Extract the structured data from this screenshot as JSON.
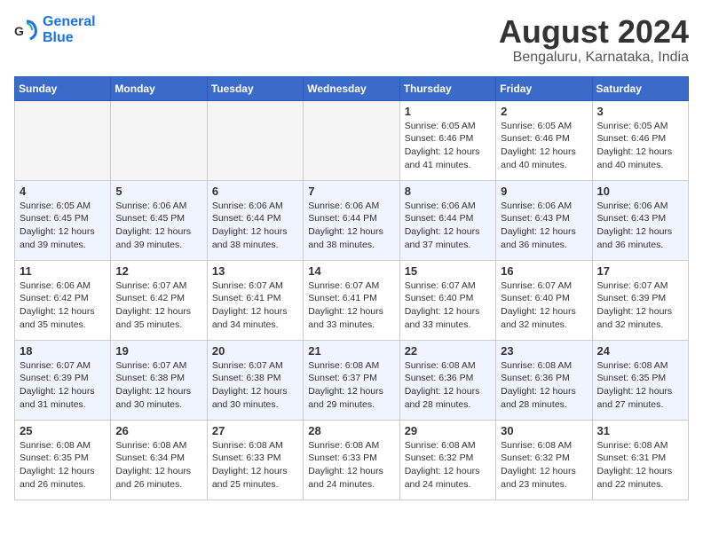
{
  "header": {
    "logo_line1": "General",
    "logo_line2": "Blue",
    "month_year": "August 2024",
    "location": "Bengaluru, Karnataka, India"
  },
  "weekdays": [
    "Sunday",
    "Monday",
    "Tuesday",
    "Wednesday",
    "Thursday",
    "Friday",
    "Saturday"
  ],
  "weeks": [
    [
      {
        "day": "",
        "info": ""
      },
      {
        "day": "",
        "info": ""
      },
      {
        "day": "",
        "info": ""
      },
      {
        "day": "",
        "info": ""
      },
      {
        "day": "1",
        "info": "Sunrise: 6:05 AM\nSunset: 6:46 PM\nDaylight: 12 hours\nand 41 minutes."
      },
      {
        "day": "2",
        "info": "Sunrise: 6:05 AM\nSunset: 6:46 PM\nDaylight: 12 hours\nand 40 minutes."
      },
      {
        "day": "3",
        "info": "Sunrise: 6:05 AM\nSunset: 6:46 PM\nDaylight: 12 hours\nand 40 minutes."
      }
    ],
    [
      {
        "day": "4",
        "info": "Sunrise: 6:05 AM\nSunset: 6:45 PM\nDaylight: 12 hours\nand 39 minutes."
      },
      {
        "day": "5",
        "info": "Sunrise: 6:06 AM\nSunset: 6:45 PM\nDaylight: 12 hours\nand 39 minutes."
      },
      {
        "day": "6",
        "info": "Sunrise: 6:06 AM\nSunset: 6:44 PM\nDaylight: 12 hours\nand 38 minutes."
      },
      {
        "day": "7",
        "info": "Sunrise: 6:06 AM\nSunset: 6:44 PM\nDaylight: 12 hours\nand 38 minutes."
      },
      {
        "day": "8",
        "info": "Sunrise: 6:06 AM\nSunset: 6:44 PM\nDaylight: 12 hours\nand 37 minutes."
      },
      {
        "day": "9",
        "info": "Sunrise: 6:06 AM\nSunset: 6:43 PM\nDaylight: 12 hours\nand 36 minutes."
      },
      {
        "day": "10",
        "info": "Sunrise: 6:06 AM\nSunset: 6:43 PM\nDaylight: 12 hours\nand 36 minutes."
      }
    ],
    [
      {
        "day": "11",
        "info": "Sunrise: 6:06 AM\nSunset: 6:42 PM\nDaylight: 12 hours\nand 35 minutes."
      },
      {
        "day": "12",
        "info": "Sunrise: 6:07 AM\nSunset: 6:42 PM\nDaylight: 12 hours\nand 35 minutes."
      },
      {
        "day": "13",
        "info": "Sunrise: 6:07 AM\nSunset: 6:41 PM\nDaylight: 12 hours\nand 34 minutes."
      },
      {
        "day": "14",
        "info": "Sunrise: 6:07 AM\nSunset: 6:41 PM\nDaylight: 12 hours\nand 33 minutes."
      },
      {
        "day": "15",
        "info": "Sunrise: 6:07 AM\nSunset: 6:40 PM\nDaylight: 12 hours\nand 33 minutes."
      },
      {
        "day": "16",
        "info": "Sunrise: 6:07 AM\nSunset: 6:40 PM\nDaylight: 12 hours\nand 32 minutes."
      },
      {
        "day": "17",
        "info": "Sunrise: 6:07 AM\nSunset: 6:39 PM\nDaylight: 12 hours\nand 32 minutes."
      }
    ],
    [
      {
        "day": "18",
        "info": "Sunrise: 6:07 AM\nSunset: 6:39 PM\nDaylight: 12 hours\nand 31 minutes."
      },
      {
        "day": "19",
        "info": "Sunrise: 6:07 AM\nSunset: 6:38 PM\nDaylight: 12 hours\nand 30 minutes."
      },
      {
        "day": "20",
        "info": "Sunrise: 6:07 AM\nSunset: 6:38 PM\nDaylight: 12 hours\nand 30 minutes."
      },
      {
        "day": "21",
        "info": "Sunrise: 6:08 AM\nSunset: 6:37 PM\nDaylight: 12 hours\nand 29 minutes."
      },
      {
        "day": "22",
        "info": "Sunrise: 6:08 AM\nSunset: 6:36 PM\nDaylight: 12 hours\nand 28 minutes."
      },
      {
        "day": "23",
        "info": "Sunrise: 6:08 AM\nSunset: 6:36 PM\nDaylight: 12 hours\nand 28 minutes."
      },
      {
        "day": "24",
        "info": "Sunrise: 6:08 AM\nSunset: 6:35 PM\nDaylight: 12 hours\nand 27 minutes."
      }
    ],
    [
      {
        "day": "25",
        "info": "Sunrise: 6:08 AM\nSunset: 6:35 PM\nDaylight: 12 hours\nand 26 minutes."
      },
      {
        "day": "26",
        "info": "Sunrise: 6:08 AM\nSunset: 6:34 PM\nDaylight: 12 hours\nand 26 minutes."
      },
      {
        "day": "27",
        "info": "Sunrise: 6:08 AM\nSunset: 6:33 PM\nDaylight: 12 hours\nand 25 minutes."
      },
      {
        "day": "28",
        "info": "Sunrise: 6:08 AM\nSunset: 6:33 PM\nDaylight: 12 hours\nand 24 minutes."
      },
      {
        "day": "29",
        "info": "Sunrise: 6:08 AM\nSunset: 6:32 PM\nDaylight: 12 hours\nand 24 minutes."
      },
      {
        "day": "30",
        "info": "Sunrise: 6:08 AM\nSunset: 6:32 PM\nDaylight: 12 hours\nand 23 minutes."
      },
      {
        "day": "31",
        "info": "Sunrise: 6:08 AM\nSunset: 6:31 PM\nDaylight: 12 hours\nand 22 minutes."
      }
    ]
  ]
}
